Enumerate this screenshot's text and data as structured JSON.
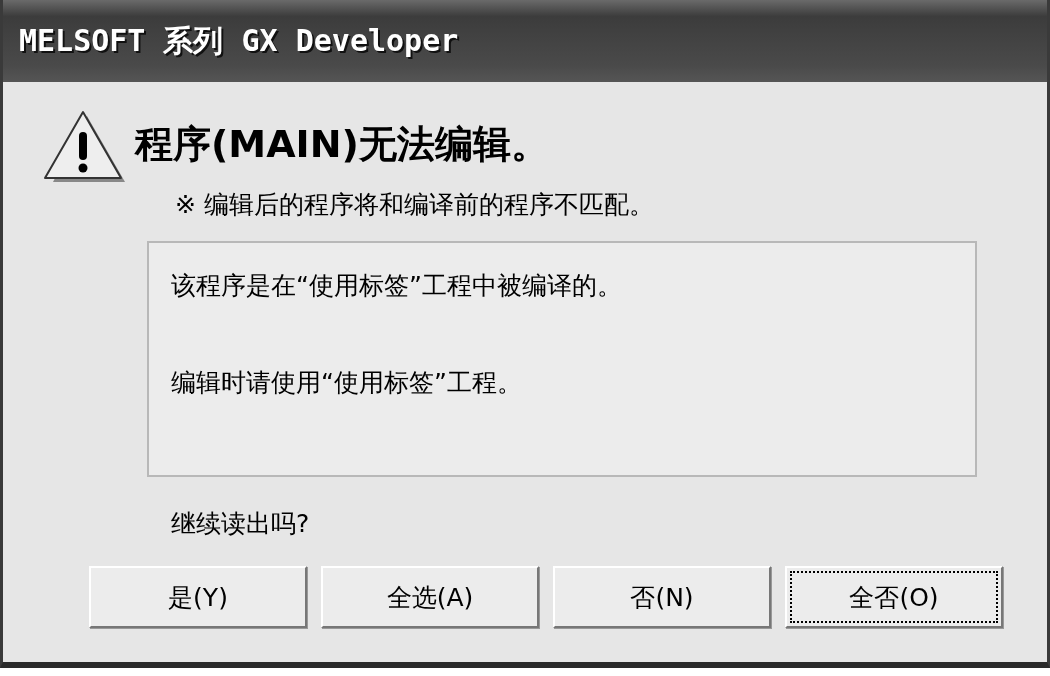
{
  "window": {
    "title": "MELSOFT 系列 GX Developer"
  },
  "heading": "程序(MAIN)无法编辑。",
  "note": "※ 编辑后的程序将和编译前的程序不匹配。",
  "message_lines": [
    "该程序是在“使用标签”工程中被编译的。",
    "编辑时请使用“使用标签”工程。"
  ],
  "question": "继续读出吗?",
  "buttons": [
    {
      "label": "是(Y)",
      "focused": false
    },
    {
      "label": "全选(A)",
      "focused": false
    },
    {
      "label": "否(N)",
      "focused": false
    },
    {
      "label": "全否(O)",
      "focused": true
    }
  ]
}
